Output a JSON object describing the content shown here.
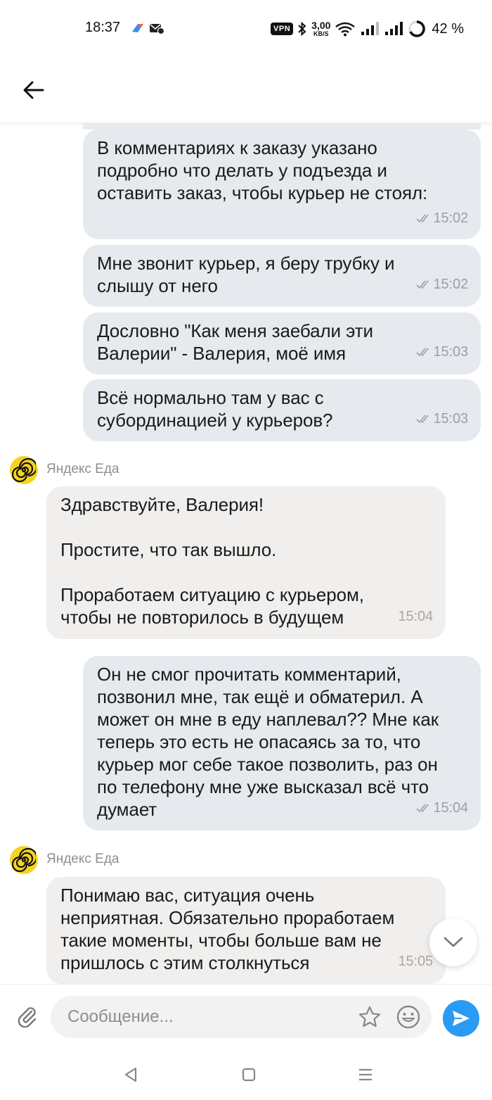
{
  "status_bar": {
    "time": "18:37",
    "vpn_label": "VPN",
    "net_speed": "3,00",
    "net_unit": "KB/S",
    "battery": "42 %",
    "icons": [
      "app-icon",
      "mail-icon",
      "bluetooth-icon",
      "wifi-icon",
      "signal-icon",
      "signal-icon",
      "battery-ring-icon"
    ]
  },
  "header": {
    "back_icon": "arrow-left-icon"
  },
  "messages": [
    {
      "direction": "out",
      "text": "В комментариях к заказу указано\nподробно что делать у подъезда и\nоставить заказ, чтобы курьер не стоял:",
      "time": "15:02",
      "read": true
    },
    {
      "direction": "out",
      "text": "Мне звонит курьер, я беру трубку и\nслышу от него",
      "time": "15:02",
      "read": true
    },
    {
      "direction": "out",
      "text": "Дословно \"Как меня заебали эти\nВалерии\" - Валерия, моё имя",
      "time": "15:03",
      "read": true
    },
    {
      "direction": "out",
      "text": "Всё нормально там у вас с\nсубординацией у курьеров?",
      "time": "15:03",
      "read": true
    },
    {
      "direction": "in",
      "sender": "Яндекс Еда",
      "text": "Здравствуйте, Валерия!\n\nПростите, что так вышло.\n\nПроработаем ситуацию с курьером,\nчтобы не повторилось в будущем",
      "time": "15:04"
    },
    {
      "direction": "out",
      "text": "Он не смог прочитать комментарий,\nпозвонил мне, так ещё и обматерил. А\nможет он мне в еду наплевал?? Мне как\nтеперь это есть не опасаясь за то, что\nкурьер мог себе такое позволить, раз он\nпо телефону мне уже высказал всё что\nдумает",
      "time": "15:04",
      "read": true
    },
    {
      "direction": "in",
      "sender": "Яндекс Еда",
      "text": "Понимаю вас, ситуация очень\nнеприятная. Обязательно проработаем\nтакие моменты, чтобы больше вам не\nпришлось с этим столкнуться",
      "time": "15:05"
    }
  ],
  "composer": {
    "placeholder": "Сообщение...",
    "value": "",
    "icons": [
      "paperclip-icon",
      "star-icon",
      "emoji-icon",
      "send-icon"
    ]
  },
  "colors": {
    "outgoing_bubble": "#e6eaee",
    "incoming_bubble": "#f1efed",
    "avatar_yellow": "#f5d321",
    "send_button": "#2a9af3"
  }
}
